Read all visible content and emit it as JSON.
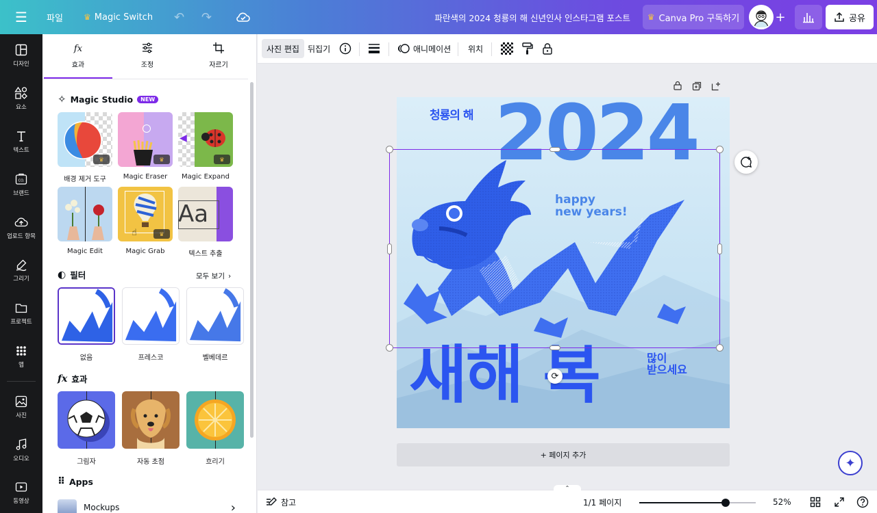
{
  "topbar": {
    "file_label": "파일",
    "magic_switch_label": "Magic Switch",
    "doc_title": "파란색의 2024 청룡의 해 신년인사 인스타그램 포스트",
    "pro_label": "Canva Pro 구독하기",
    "share_label": "공유"
  },
  "rail": {
    "items": [
      {
        "label": "디자인",
        "icon": "design-icon"
      },
      {
        "label": "요소",
        "icon": "elements-icon"
      },
      {
        "label": "텍스트",
        "icon": "text-icon"
      },
      {
        "label": "브랜드",
        "icon": "brand-icon"
      },
      {
        "label": "업로드 항목",
        "icon": "upload-icon"
      },
      {
        "label": "그리기",
        "icon": "draw-icon"
      },
      {
        "label": "프로젝트",
        "icon": "folder-icon"
      },
      {
        "label": "앱",
        "icon": "apps-icon"
      },
      {
        "label": "사진",
        "icon": "photo-icon"
      },
      {
        "label": "오디오",
        "icon": "audio-icon"
      },
      {
        "label": "동영상",
        "icon": "video-icon"
      }
    ]
  },
  "panel": {
    "tabs": [
      {
        "label": "효과",
        "active": true
      },
      {
        "label": "조정",
        "active": false
      },
      {
        "label": "자르기",
        "active": false
      }
    ],
    "magic_studio": {
      "title": "Magic Studio",
      "badge": "NEW",
      "tools": [
        {
          "label": "배경 제거 도구"
        },
        {
          "label": "Magic Eraser"
        },
        {
          "label": "Magic Expand"
        },
        {
          "label": "Magic Edit"
        },
        {
          "label": "Magic Grab"
        },
        {
          "label": "텍스트 추출"
        }
      ]
    },
    "filters": {
      "title": "필터",
      "see_all": "모두 보기",
      "items": [
        {
          "label": "없음",
          "selected": true
        },
        {
          "label": "프레스코",
          "selected": false
        },
        {
          "label": "벨베데르",
          "selected": false
        }
      ]
    },
    "effects": {
      "title": "효과",
      "items": [
        {
          "label": "그림자"
        },
        {
          "label": "자동 초점"
        },
        {
          "label": "흐리기"
        }
      ]
    },
    "apps": {
      "title": "Apps",
      "first_item": "Mockups"
    }
  },
  "context_toolbar": {
    "edit_photo": "사진 편집",
    "flip": "뒤집기",
    "animate": "애니메이션",
    "position": "위치"
  },
  "design": {
    "top_small": "청룡의 해",
    "year": "2024",
    "greeting_line1": "happy",
    "greeting_line2": "new years!",
    "big_text": "새해 복",
    "side_line1": "많이",
    "side_line2": "받으세요",
    "colors": {
      "accent": "#2b55f0",
      "year": "#4a86e8",
      "sky": "#d6ecf8"
    }
  },
  "canvas": {
    "add_page": "+ 페이지 추가"
  },
  "bottombar": {
    "notes": "참고",
    "page_indicator": "1/1 페이지",
    "zoom": "52%",
    "zoom_level": 0.52
  }
}
